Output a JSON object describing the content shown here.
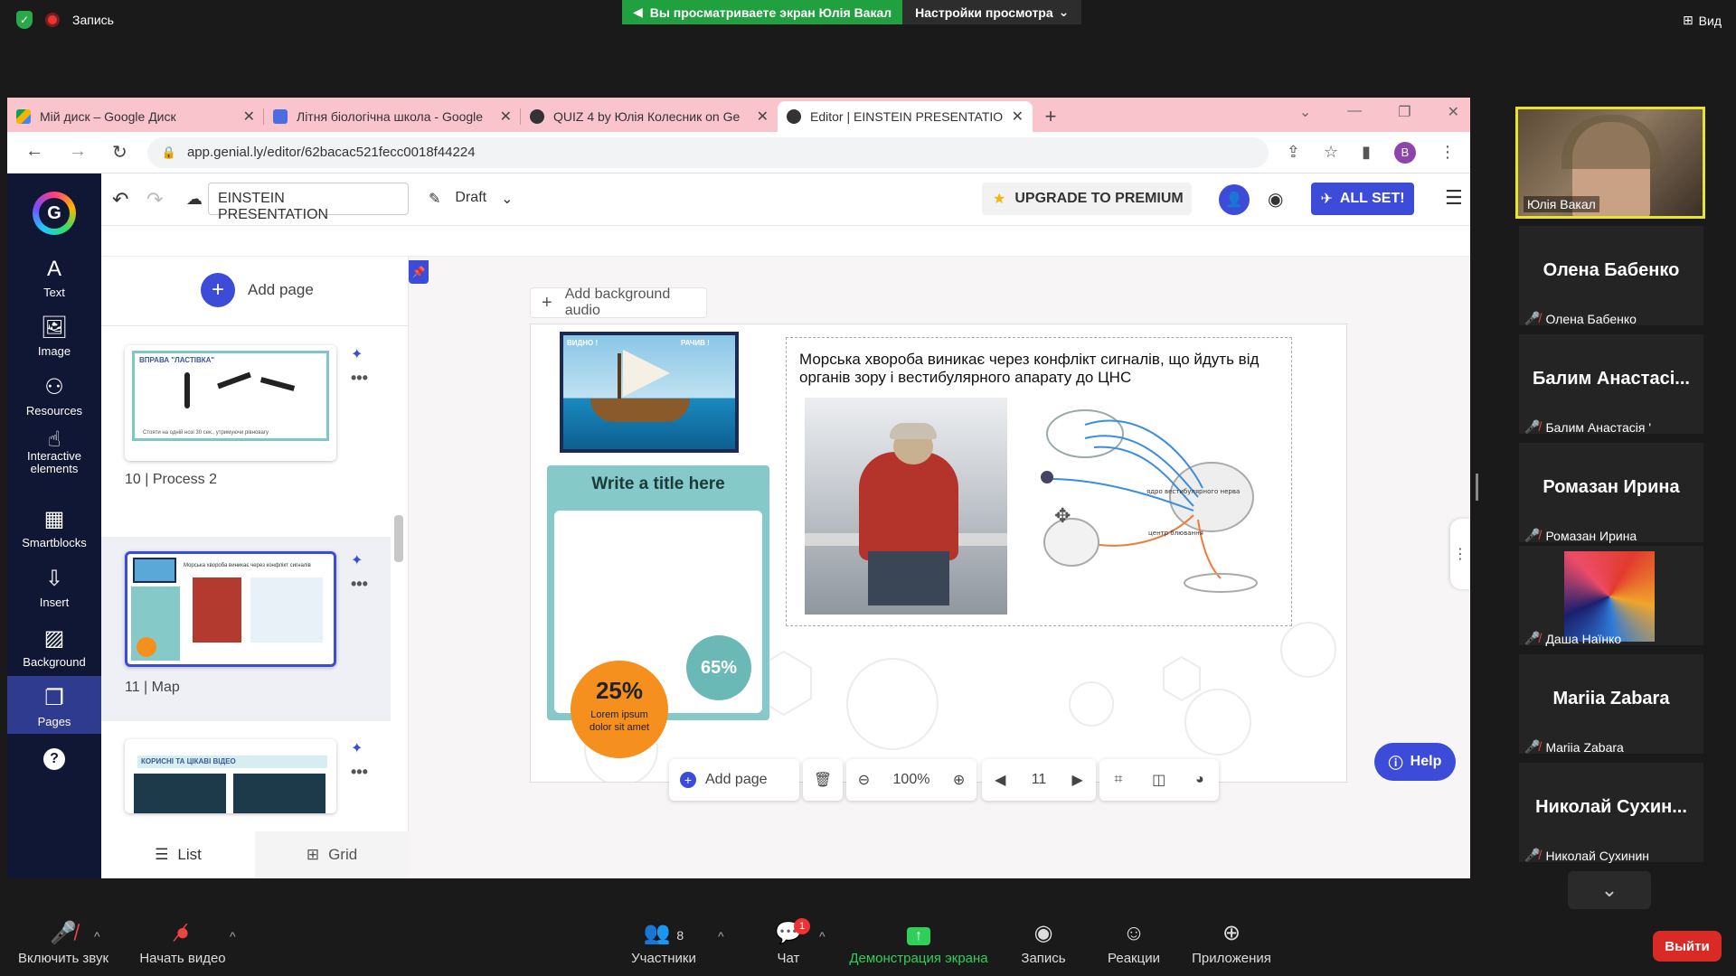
{
  "zoom_top": {
    "recording_label": "Запись",
    "share_banner": "Вы просматриваете экран Юлія Вакал",
    "view_settings": "Настройки просмотра",
    "view_label": "Вид"
  },
  "browser": {
    "tabs": [
      {
        "title": "Мій диск – Google Диск",
        "color": "#f4b400"
      },
      {
        "title": "Літня біологічна школа - Google",
        "color": "#4a6ee0"
      },
      {
        "title": "QUIZ 4 by Юлія Колесник on Ge",
        "color": "#333333"
      },
      {
        "title": "Editor | EINSTEIN PRESENTATION",
        "color": "#333333"
      }
    ],
    "url": "app.genial.ly/editor/62bacac521fecc0018f44224",
    "profile_initial": "B"
  },
  "genially": {
    "rail": [
      {
        "label": "Text",
        "icon": "text-icon",
        "glyph": "A"
      },
      {
        "label": "Image",
        "icon": "image-icon",
        "glyph": "🖼"
      },
      {
        "label": "Resources",
        "icon": "resources-icon",
        "glyph": "⚇"
      },
      {
        "label": "Interactive elements",
        "icon": "interactive-icon",
        "glyph": "☝"
      },
      {
        "label": "Smartblocks",
        "icon": "smartblocks-icon",
        "glyph": "▦"
      },
      {
        "label": "Insert",
        "icon": "insert-icon",
        "glyph": "⇩"
      },
      {
        "label": "Background",
        "icon": "background-icon",
        "glyph": "▨"
      },
      {
        "label": "Pages",
        "icon": "pages-icon",
        "glyph": "❐"
      }
    ],
    "help_glyph": "?",
    "title": "EINSTEIN PRESENTATION",
    "status": "Draft",
    "upgrade": "UPGRADE TO PREMIUM",
    "all_set": "ALL SET!",
    "panel": {
      "add_page": "Add page",
      "pages": [
        {
          "number": "10",
          "name": "Process 2",
          "header": "ВПРАВА \"ЛАСТІВКА\"",
          "caption": "Стояти на одній нозі 30 сек., утримуючи рівновагу"
        },
        {
          "number": "11",
          "name": "Map"
        },
        {
          "number": "12",
          "name": "",
          "header": "КОРИСНІ ТА ЦІКАВІ ВІДЕО"
        }
      ],
      "list_label": "List",
      "grid_label": "Grid"
    },
    "canvas": {
      "add_background_audio": "Add background audio",
      "slide_text": "Морська хвороба виникає через конфлікт сигналів, що йдуть від органів зору і вестибулярного апарату до ЦНС",
      "card_title": "Write a title here",
      "percent_teal": "65%",
      "percent_orange": "25%",
      "orange_caption": "Lorem ipsum dolor sit amet",
      "diagram_label_1": "ядро вестибулярного нерва",
      "diagram_label_2": "центр блювання",
      "boat_label_left": "ВИДНО !",
      "boat_label_right": "РАЧИВ !",
      "add_page": "Add page",
      "zoom": "100%",
      "page_number": "11",
      "help": "Help"
    }
  },
  "zoom_right": {
    "main_video_name": "Юлія Вакал",
    "participants": [
      {
        "big": "Олена Бабенко",
        "small": "Олена Бабенко"
      },
      {
        "big": "Балим  Анастасі...",
        "small": "Балим Анастасія '"
      },
      {
        "big": "Ромазан Ирина",
        "small": "Ромазан Ирина"
      },
      {
        "big": "",
        "small": "Даша Наїнко"
      },
      {
        "big": "Mariia Zabara",
        "small": "Mariia Zabara"
      },
      {
        "big": "Николай  Сухин...",
        "small": "Николай Сухинин"
      }
    ]
  },
  "zoom_bottom": {
    "unmute": "Включить звук",
    "start_video": "Начать видео",
    "participants": "Участники",
    "participants_count": "8",
    "chat": "Чат",
    "chat_badge": "1",
    "share": "Демонстрация экрана",
    "record": "Запись",
    "reactions": "Реакции",
    "apps": "Приложения",
    "leave": "Выйти"
  }
}
